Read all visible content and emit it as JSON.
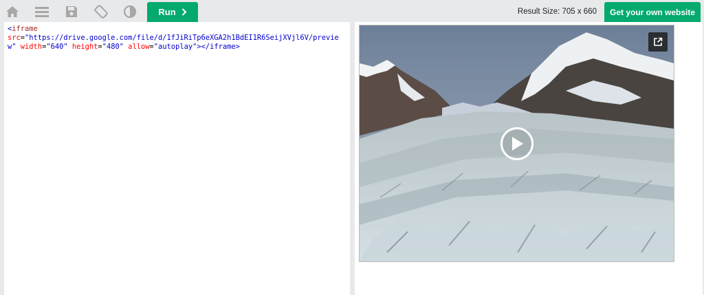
{
  "toolbar": {
    "icons": [
      "home-icon",
      "menu-icon",
      "save-icon",
      "rotate-icon",
      "contrast-icon"
    ],
    "run_label": "Run",
    "result_size": "Result Size: 705 x 660",
    "get_website_label": "Get your own website",
    "accent_color": "#04aa6d"
  },
  "editor": {
    "open_bracket": "<",
    "tag": "iframe",
    "src_attr": "src",
    "src_value": "\"https://drive.google.com/file/d/1fJiRiTp6eXGA2h1BdEI1R6SeijXVjl6V/preview\"",
    "width_attr": "width",
    "width_value": "\"640\"",
    "height_attr": "height",
    "height_value": "\"480\"",
    "allow_attr": "allow",
    "allow_value": "\"autoplay\"",
    "close_tag": "></iframe>",
    "equals": "="
  },
  "result": {
    "video": {
      "popout_icon": "open-in-new-icon",
      "play_icon": "play-icon",
      "subject": "glacier-mountain-landscape"
    }
  }
}
